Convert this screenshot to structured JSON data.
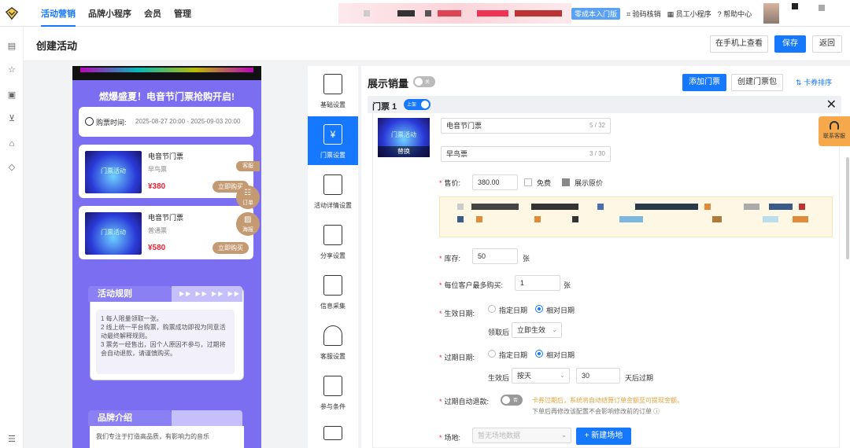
{
  "topnav": {
    "items": [
      "活动营销",
      "品牌小程序",
      "会员",
      "管理"
    ],
    "active": "活动营销",
    "badge": "零成本入门版",
    "links": [
      "验码核销",
      "员工小程序",
      "帮助中心"
    ]
  },
  "header": {
    "title": "创建活动",
    "view_mobile": "在手机上查看",
    "save": "保存",
    "back": "返回"
  },
  "preview": {
    "banner": "燃爆盛夏！电音节门票抢购开启!",
    "time_label": "购票时间:",
    "time_value": "2025-08-27 20:00 - 2025-09-03 20:00",
    "tickets": [
      {
        "name": "电音节门票",
        "sub": "早鸟票",
        "price": "¥380",
        "buy": "立即购买",
        "img_text": "门票活动"
      },
      {
        "name": "电音节门票",
        "sub": "普通票",
        "price": "¥580",
        "buy": "立即购买",
        "img_text": "门票活动"
      }
    ],
    "float_tags": [
      "客服",
      "订单",
      "海报"
    ],
    "rules_title": "活动规则",
    "rules_lines": [
      "1 每人限量领取一张。",
      "2 线上统一平台购票，购票成功即视为同意活动最终解释规则。",
      "3 票务一经售出，因个人原因不参与，过期将会自动退款，请谨慎购买。"
    ],
    "brand_title": "品牌介绍",
    "brand_text": "我们专注于打造高品质，有影响力的音乐"
  },
  "steps": [
    {
      "label": "基础设置",
      "icon": "document-icon"
    },
    {
      "label": "门票设置",
      "icon": "ticket-icon"
    },
    {
      "label": "活动详情设置",
      "icon": "details-icon"
    },
    {
      "label": "分享设置",
      "icon": "share-icon"
    },
    {
      "label": "信息采集",
      "icon": "form-icon"
    },
    {
      "label": "客服设置",
      "icon": "headset-icon"
    },
    {
      "label": "参与条件",
      "icon": "flag-icon"
    }
  ],
  "active_step": "门票设置",
  "panel": {
    "show_sales": "展示销量",
    "show_sales_toggle": "关",
    "add_ticket": "添加门票",
    "create_pack": "创建门票包",
    "sort": "卡券排序",
    "ticket_title": "门票 1",
    "on_shelf": "上架",
    "replace": "替换",
    "image_text": "门票活动",
    "name_value": "电音节门票",
    "name_count": "5 / 32",
    "sub_value": "早鸟票",
    "sub_count": "3 / 30",
    "price_label": "售价:",
    "price_value": "380.00",
    "free_label": "免费",
    "show_original": "展示原价",
    "stock_label": "库存:",
    "stock_value": "50",
    "stock_unit": "张",
    "limit_label": "每位客户最多购买:",
    "limit_value": "1",
    "limit_unit": "张",
    "effective_label": "生效日期:",
    "opt_fixed": "指定日期",
    "opt_relative": "相对日期",
    "after_claim": "领取后",
    "effective_select": "立即生效",
    "expire_label": "过期日期:",
    "after_effective": "生效后",
    "expire_unit_select": "按天",
    "expire_days": "30",
    "expire_suffix": "天后过期",
    "auto_refund_label": "过期自动退款:",
    "auto_refund_toggle": "否",
    "auto_refund_hint": "卡券过期后，系统将自动结算订单金额至可提现金额。",
    "auto_refund_hint2": "下单后再修改该配置不会影响修改前的订单",
    "venue_label": "场地:",
    "venue_placeholder": "暂无场地数据",
    "new_venue": "+ 新建场地"
  },
  "help": "联系客服",
  "colors": {
    "primary": "#1677ff",
    "preview_bg": "#7b6ef0",
    "price": "#e62233",
    "buy": "#c49a72",
    "hint": "#e6a23c"
  }
}
